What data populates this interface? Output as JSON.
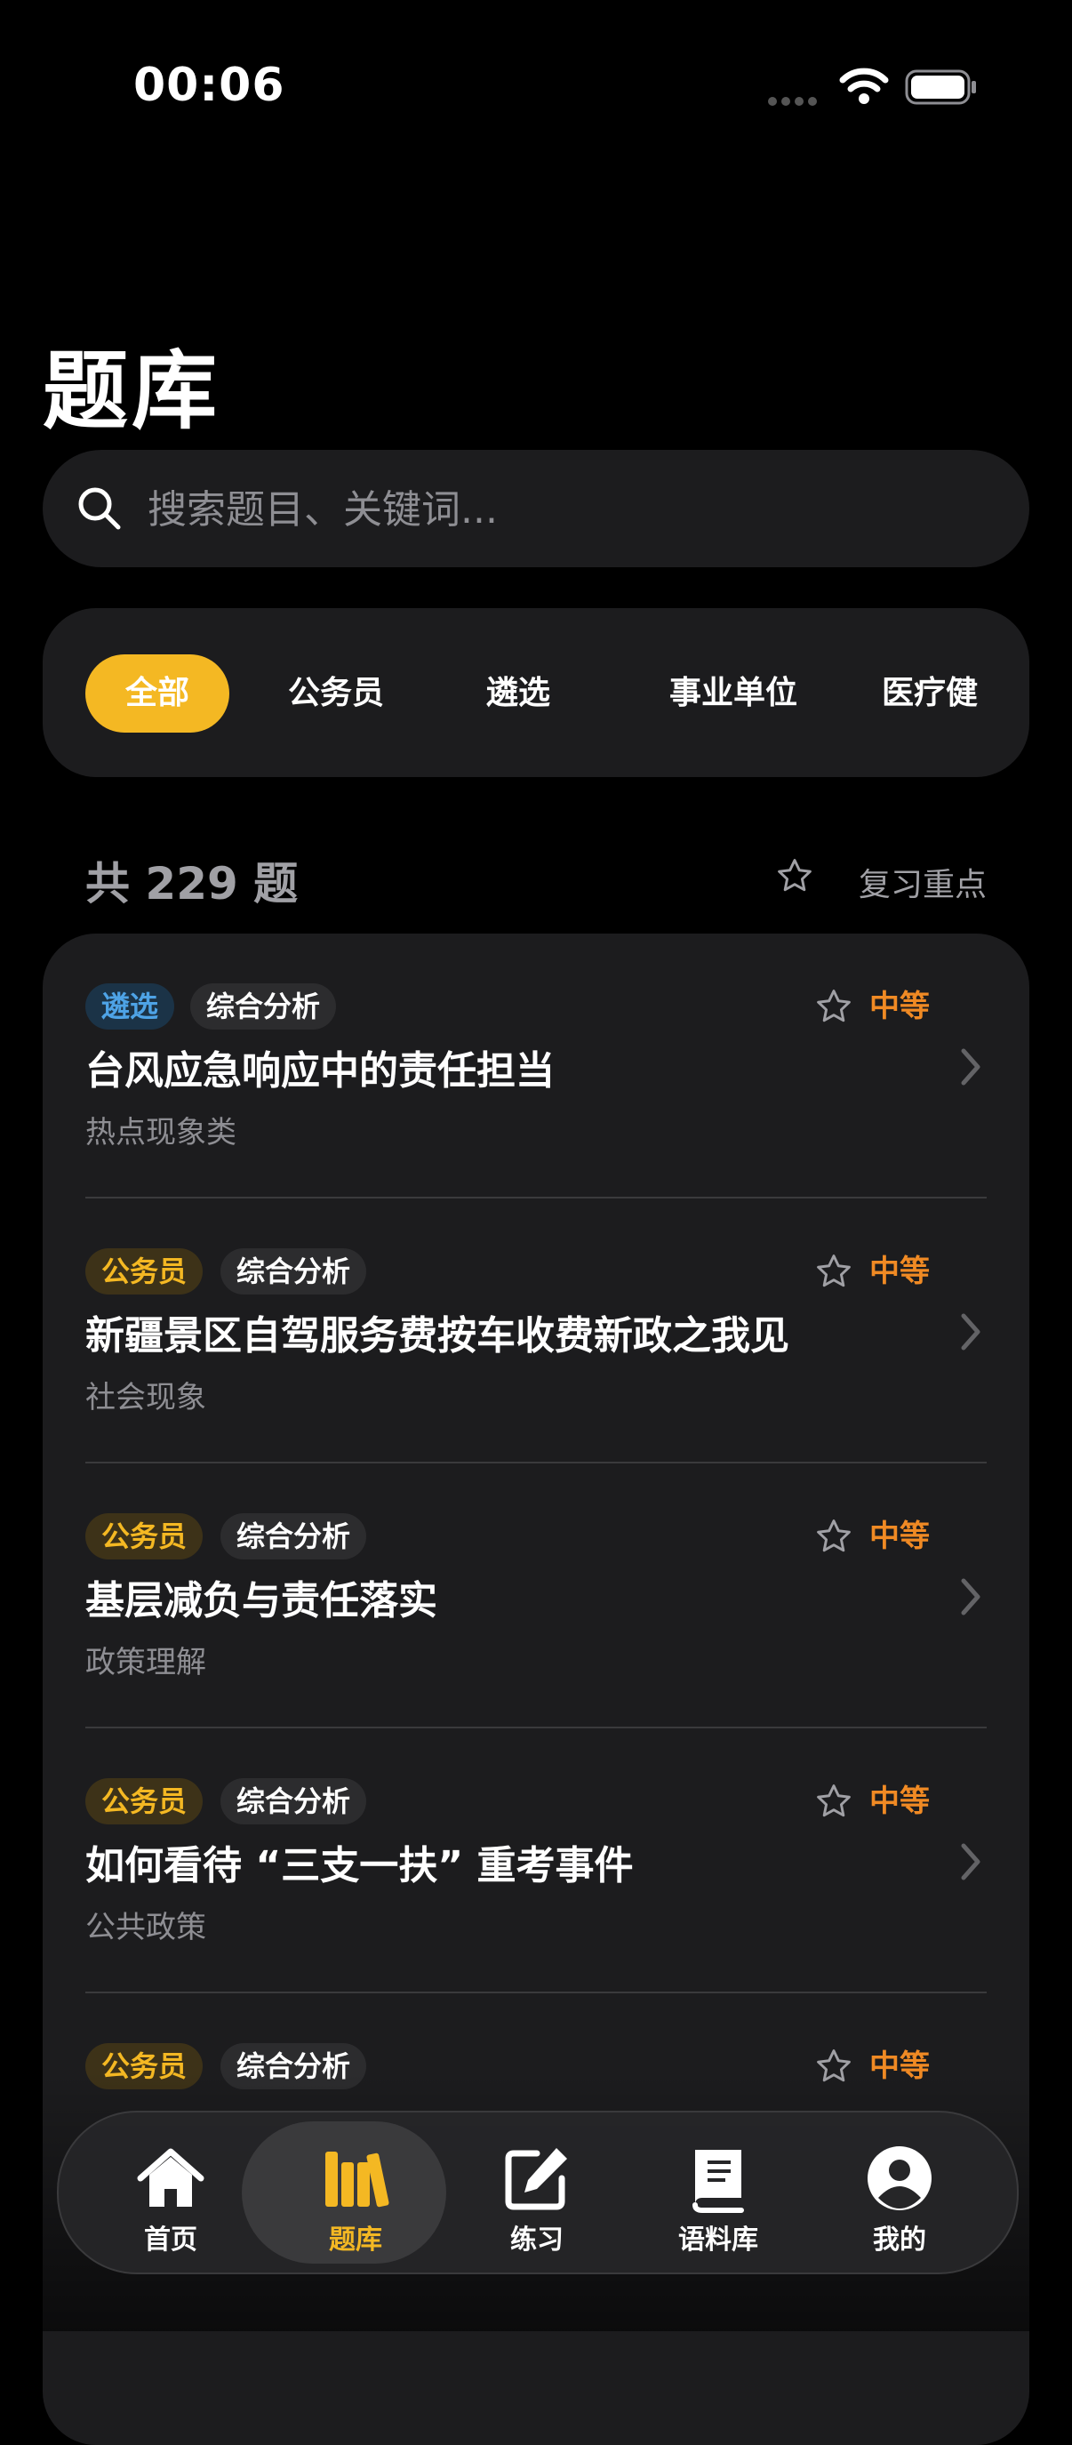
{
  "status_bar": {
    "time": "00:06"
  },
  "page": {
    "title": "题库"
  },
  "search": {
    "placeholder": "搜索题目、关键词..."
  },
  "filters": {
    "tabs": [
      {
        "label": "全部",
        "active": true
      },
      {
        "label": "公务员",
        "active": false
      },
      {
        "label": "遴选",
        "active": false
      },
      {
        "label": "事业单位",
        "active": false
      },
      {
        "label": "医疗健",
        "active": false
      }
    ]
  },
  "summary": {
    "count_text": "共 229 题",
    "review_label": "复习重点"
  },
  "questions": [
    {
      "category": "遴选",
      "type": "综合分析",
      "title": "台风应急响应中的责任担当",
      "subtitle": "热点现象类",
      "level": "中等"
    },
    {
      "category": "公务员",
      "type": "综合分析",
      "title": "新疆景区自驾服务费按车收费新政之我见",
      "subtitle": "社会现象",
      "level": "中等"
    },
    {
      "category": "公务员",
      "type": "综合分析",
      "title": "基层减负与责任落实",
      "subtitle": "政策理解",
      "level": "中等"
    },
    {
      "category": "公务员",
      "type": "综合分析",
      "title": "如何看待 “三支一扶” 重考事件",
      "subtitle": "公共政策",
      "level": "中等"
    },
    {
      "category": "公务员",
      "type": "综合分析",
      "title": "",
      "subtitle": "",
      "level": "中等"
    }
  ],
  "tabbar": {
    "items": [
      {
        "label": "首页",
        "icon": "home-icon"
      },
      {
        "label": "题库",
        "icon": "books-icon",
        "active": true
      },
      {
        "label": "练习",
        "icon": "edit-icon"
      },
      {
        "label": "语料库",
        "icon": "book-icon"
      },
      {
        "label": "我的",
        "icon": "person-icon"
      }
    ]
  },
  "colors": {
    "accent": "#f4b823",
    "level": "#f08a24",
    "category_blue": "#4ea3e6"
  }
}
